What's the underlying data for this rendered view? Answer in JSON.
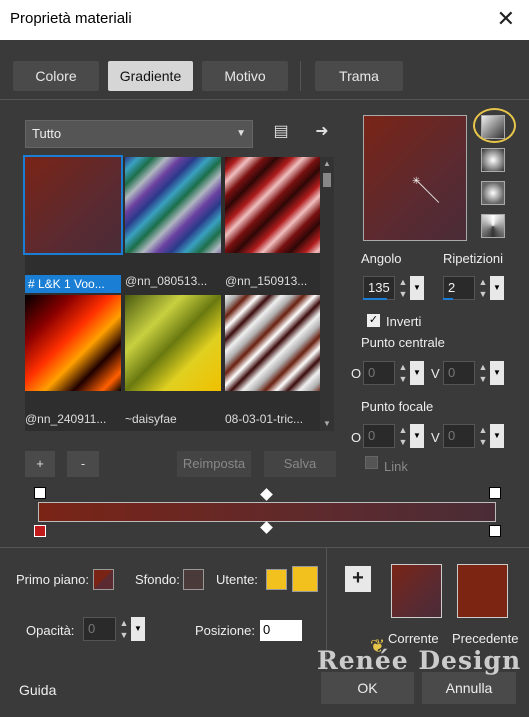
{
  "window": {
    "title": "Proprietà materiali",
    "close_icon": "close-icon"
  },
  "tabs": [
    {
      "label": "Colore",
      "active": false
    },
    {
      "label": "Gradiente",
      "active": true
    },
    {
      "label": "Motivo",
      "active": false
    },
    {
      "label": "Trama",
      "active": false
    }
  ],
  "library": {
    "category": "Tutto",
    "items": [
      {
        "label": "# L&K 1 Voo...",
        "selected": true
      },
      {
        "label": "@nn_080513...",
        "selected": false
      },
      {
        "label": "@nn_150913...",
        "selected": false
      },
      {
        "label": "@nn_240911...",
        "selected": false
      },
      {
        "label": "~daisyfae",
        "selected": false
      },
      {
        "label": "08-03-01-tric...",
        "selected": false
      }
    ],
    "add_label": "+",
    "remove_label": "-",
    "reset_label": "Reimposta",
    "save_label": "Salva"
  },
  "controls": {
    "angle_label": "Angolo",
    "angle_value": "135",
    "repeats_label": "Ripetizioni",
    "repeats_value": "2",
    "invert_label": "Inverti",
    "invert_checked": true,
    "center_label": "Punto centrale",
    "center_o_label": "O",
    "center_o_value": "0",
    "center_v_label": "V",
    "center_v_value": "0",
    "focal_label": "Punto focale",
    "focal_o_label": "O",
    "focal_o_value": "0",
    "focal_v_label": "V",
    "focal_v_value": "0",
    "link_label": "Link"
  },
  "bottom": {
    "foreground_label": "Primo piano:",
    "background_label": "Sfondo:",
    "user_label": "Utente:",
    "opacity_label": "Opacità:",
    "opacity_value": "0",
    "position_label": "Posizione:",
    "position_value": "0",
    "current_label": "Corrente",
    "previous_label": "Precedente",
    "add_label": "+"
  },
  "footer": {
    "help_label": "Guida",
    "ok_label": "OK",
    "cancel_label": "Annulla",
    "watermark": "Renée Design"
  },
  "colors": {
    "accent": "#1a7fd4",
    "gradient_start": "#7a2416",
    "gradient_end": "#4a2c38",
    "user_color": "#f2c11e",
    "previous_color": "#7b2512"
  }
}
